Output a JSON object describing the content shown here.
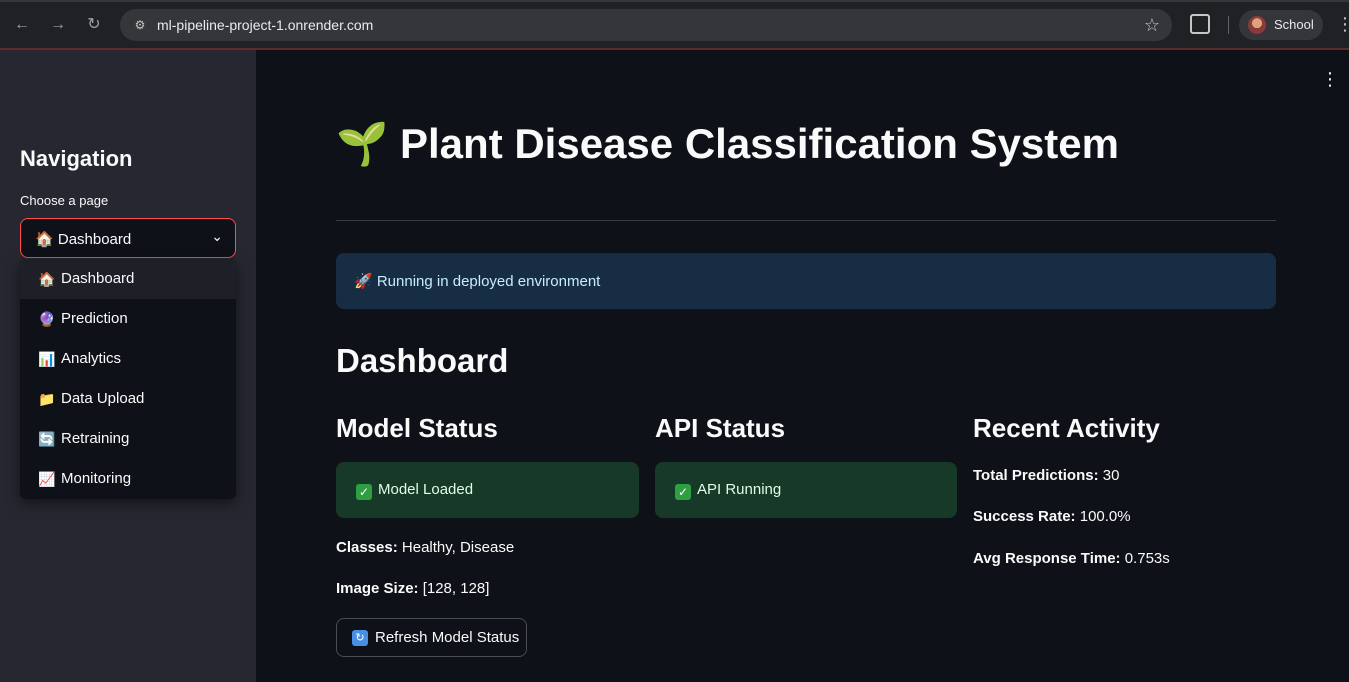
{
  "browser": {
    "url": "ml-pipeline-project-1.onrender.com",
    "profile_label": "School",
    "icons": [
      "back-arrow-icon",
      "forward-arrow-icon",
      "reload-icon",
      "site-info-icon",
      "star-icon",
      "extensions-icon",
      "kebab-menu-icon"
    ]
  },
  "sidebar": {
    "title": "Navigation",
    "select_label": "Choose a page",
    "selected": {
      "icon": "🏠",
      "label": "Dashboard"
    },
    "options": [
      {
        "icon": "🏠",
        "label": "Dashboard"
      },
      {
        "icon": "🔮",
        "label": "Prediction"
      },
      {
        "icon": "📊",
        "label": "Analytics"
      },
      {
        "icon": "📁",
        "label": "Data Upload"
      },
      {
        "icon": "🔄",
        "label": "Retraining"
      },
      {
        "icon": "📈",
        "label": "Monitoring"
      }
    ]
  },
  "main": {
    "title_icon": "🌱",
    "title": "Plant Disease Classification System",
    "info_message": "🚀 Running in deployed environment",
    "section_title": "Dashboard",
    "model_status": {
      "heading": "Model Status",
      "badge": "Model Loaded",
      "classes_label": "Classes:",
      "classes_value": "Healthy, Disease",
      "image_size_label": "Image Size:",
      "image_size_value": "[128, 128]",
      "refresh_button": "Refresh Model Status"
    },
    "api_status": {
      "heading": "API Status",
      "badge": "API Running"
    },
    "recent_activity": {
      "heading": "Recent Activity",
      "total_predictions_label": "Total Predictions:",
      "total_predictions_value": "30",
      "success_rate_label": "Success Rate:",
      "success_rate_value": "100.0%",
      "avg_response_label": "Avg Response Time:",
      "avg_response_value": "0.753s"
    }
  },
  "colors": {
    "accent": "#ff4b4b",
    "background": "#0e1117",
    "sidebar": "#262730",
    "info_bg": "#172d43",
    "success_bg": "#173928"
  }
}
